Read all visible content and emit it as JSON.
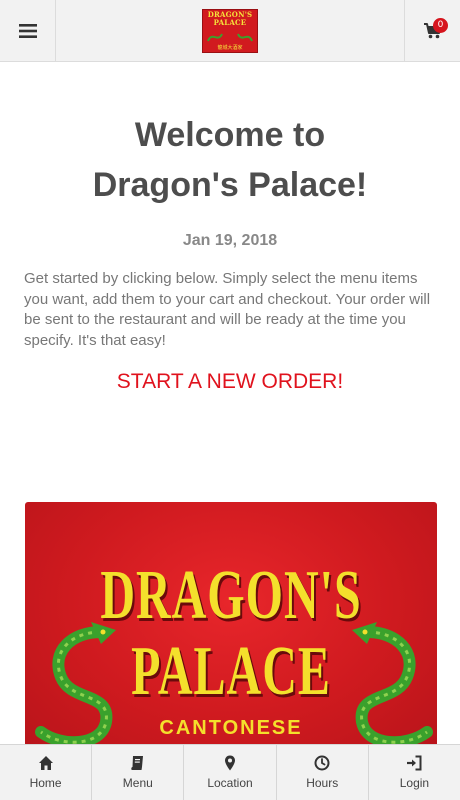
{
  "header": {
    "menu_icon": "hamburger-icon",
    "logo_line1": "DRAGON'S",
    "logo_line2": "PALACE",
    "logo_chinese": "龍城大酒家",
    "cart_icon": "shopping-cart-icon",
    "cart_count": "0"
  },
  "main": {
    "title_line1": "Welcome to",
    "title_line2": "Dragon's Palace!",
    "date": "Jan 19, 2018",
    "intro": "Get started by clicking below. Simply select the menu items you want, add them to your cart and checkout. Your order will be sent to the restaurant and will be ready at the time you specify. It's that easy!",
    "cta_label": "START A NEW ORDER!"
  },
  "banner": {
    "line1": "DRAGON'S",
    "line2": "PALACE",
    "line3": "CANTONESE"
  },
  "bottom_nav": [
    {
      "label": "Home",
      "icon": "home-icon"
    },
    {
      "label": "Menu",
      "icon": "book-icon"
    },
    {
      "label": "Location",
      "icon": "map-pin-icon"
    },
    {
      "label": "Hours",
      "icon": "clock-icon"
    },
    {
      "label": "Login",
      "icon": "sign-in-icon"
    }
  ],
  "colors": {
    "accent_red": "#e0121d",
    "badge_red": "#d6141d",
    "banner_red": "#cf1a1f",
    "banner_yellow": "#f4e02c",
    "dragon_green": "#3aa12c"
  }
}
